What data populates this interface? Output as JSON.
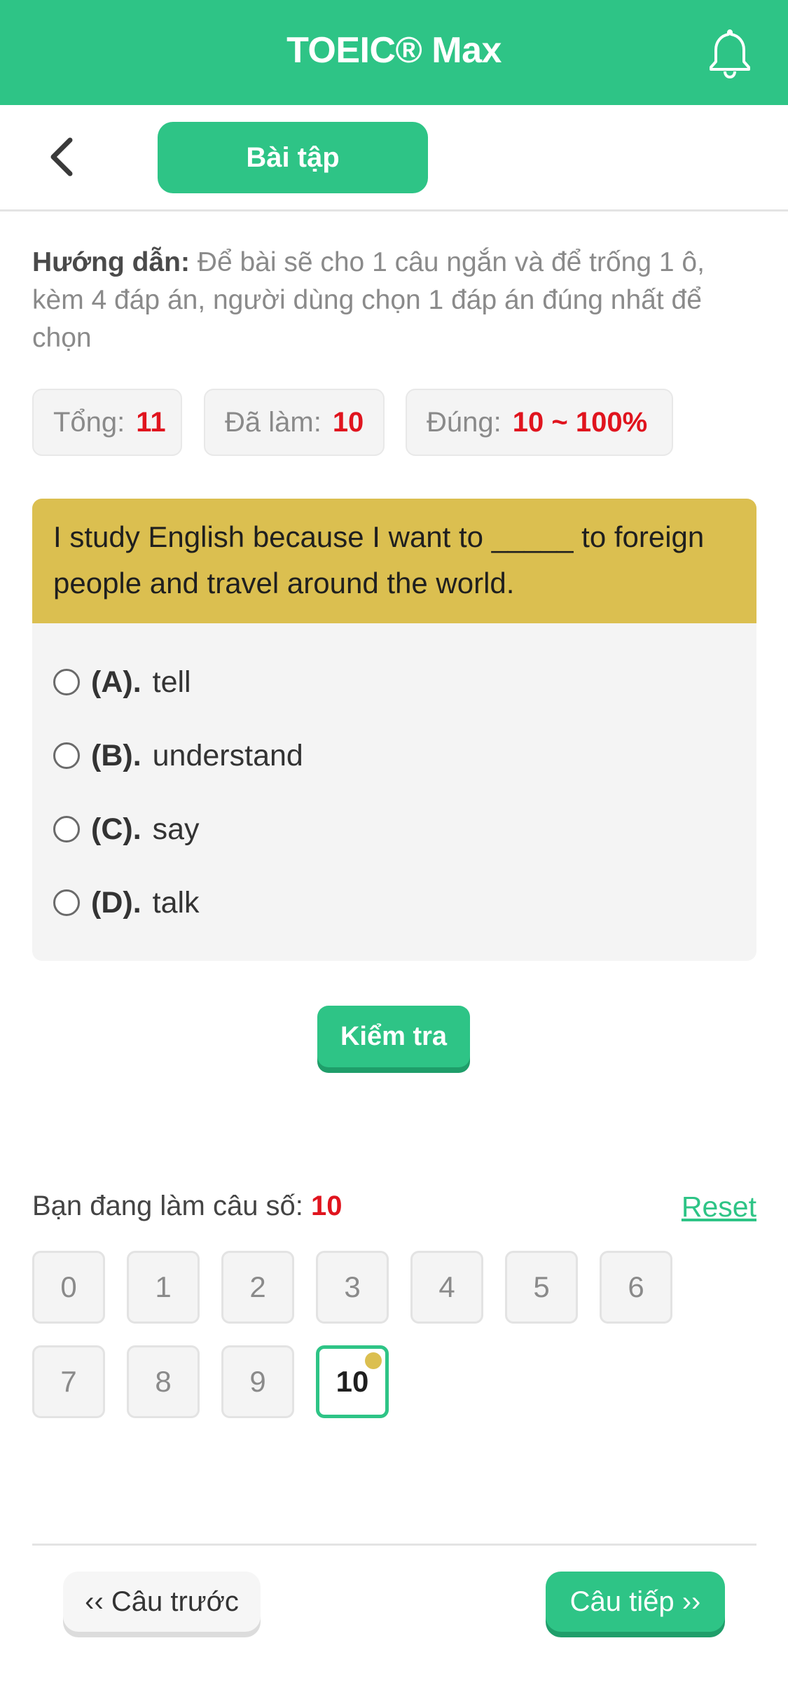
{
  "colors": {
    "brand": "#2ec486",
    "question_header": "#dbbf50",
    "highlight_value": "#e0141e"
  },
  "header": {
    "title": "TOEIC® Max",
    "right_icon": "bell-icon"
  },
  "subbar": {
    "back_icon": "chevron-left-icon",
    "tab_label": "Bài tập"
  },
  "guide": {
    "label": "Hướng dẫn:",
    "text": " Để bài sẽ cho 1 câu ngắn và để trống 1 ô, kèm 4 đáp án, người dùng chọn 1 đáp án đúng nhất để chọn"
  },
  "stats": {
    "total_label": "Tổng:",
    "total_value": "11",
    "done_label": "Đã làm:",
    "done_value": "10",
    "correct_label": "Đúng:",
    "correct_value": "10 ~ 100%"
  },
  "question": {
    "text": "I study English because I want to _____ to foreign people and travel around the world.",
    "options": [
      {
        "label": "(A).",
        "text": "tell"
      },
      {
        "label": "(B).",
        "text": "understand"
      },
      {
        "label": "(C).",
        "text": "say"
      },
      {
        "label": "(D).",
        "text": "talk"
      }
    ]
  },
  "check_button": "Kiểm tra",
  "progress": {
    "label": "Bạn đang làm câu số:",
    "current": "10",
    "reset": "Reset"
  },
  "question_numbers": [
    "0",
    "1",
    "2",
    "3",
    "4",
    "5",
    "6",
    "7",
    "8",
    "9",
    "10"
  ],
  "nav": {
    "prev": "‹‹ Câu trước",
    "next": "Câu tiếp ››"
  }
}
